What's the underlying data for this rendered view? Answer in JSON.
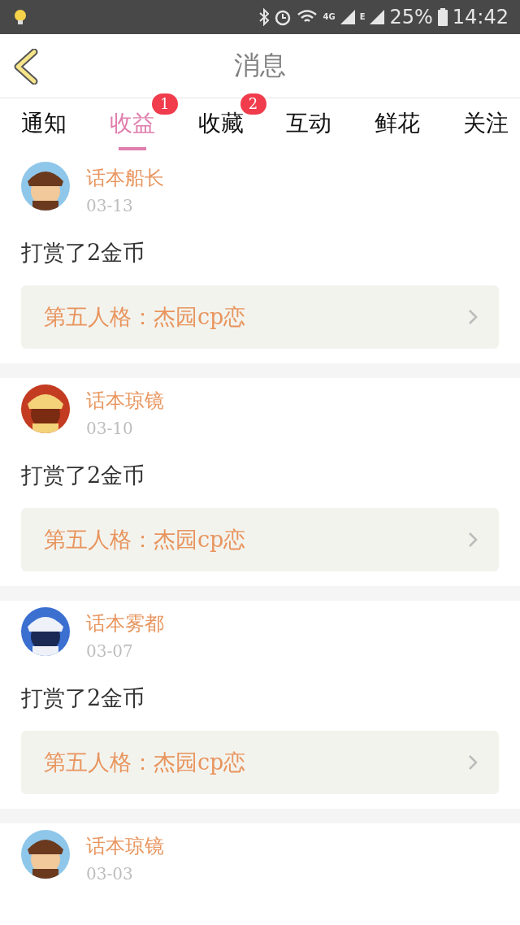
{
  "status_bar": {
    "network_1": "4G",
    "network_2": "E",
    "battery": "25%",
    "time": "14:42"
  },
  "header": {
    "title": "消息"
  },
  "tabs": [
    {
      "label": "通知",
      "selected": false
    },
    {
      "label": "收益",
      "selected": true,
      "badge": "1"
    },
    {
      "label": "收藏",
      "selected": false,
      "badge": "2"
    },
    {
      "label": "互动",
      "selected": false
    },
    {
      "label": "鲜花",
      "selected": false
    },
    {
      "label": "关注",
      "selected": false
    }
  ],
  "messages": [
    {
      "name": "话本船长",
      "date": "03-13",
      "text": "打赏了2金币",
      "link": "第五人格：杰园cp恋"
    },
    {
      "name": "话本琼镜",
      "date": "03-10",
      "text": "打赏了2金币",
      "link": "第五人格：杰园cp恋"
    },
    {
      "name": "话本雾都",
      "date": "03-07",
      "text": "打赏了2金币",
      "link": "第五人格：杰园cp恋"
    },
    {
      "name": "话本琼镜",
      "date": "03-03"
    }
  ]
}
